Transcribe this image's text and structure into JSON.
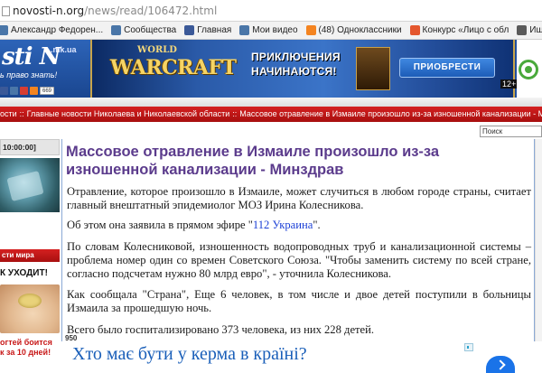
{
  "browser": {
    "url_host": "novosti-n.org",
    "url_path": "/news/read/106472.html"
  },
  "bookmarks": [
    {
      "label": "Александр Федорен...",
      "icon": "vk-icon",
      "color": "#4a76a8"
    },
    {
      "label": "Сообщества",
      "icon": "vk-icon",
      "color": "#4a76a8"
    },
    {
      "label": "Главная",
      "icon": "facebook-icon",
      "color": "#3b5998"
    },
    {
      "label": "Мои видео",
      "icon": "vk-icon",
      "color": "#4a76a8"
    },
    {
      "label": "(48) Одноклассники",
      "icon": "odnoklassniki-icon",
      "color": "#f48420"
    },
    {
      "label": "Конкурс «Лицо с обл",
      "icon": "odnoklassniki-icon",
      "color": "#e4572e"
    },
    {
      "label": "Ищу вокалиста - Ку",
      "icon": "zaycev-icon",
      "color": "#5a5a5a"
    }
  ],
  "site": {
    "logo_text": "sti N",
    "logo_domain": ".mk.ua",
    "logo_tagline": "ь право знать!",
    "social_count": "669",
    "banner": {
      "brand_line1": "WORLD",
      "brand_line2": "WARCRAFT",
      "promo_line1": "ПРИКЛЮЧЕНИЯ",
      "promo_line2": "НАЧИНАЮТСЯ!",
      "button": "ПРИОБРЕСТИ",
      "age": "12+"
    }
  },
  "breadcrumbs": [
    "ости",
    "Главные новости Николаева и Николаевской области",
    "Массовое отравление в Измаиле произошло из-за изношенной канализации - Минздрав"
  ],
  "search": {
    "value": "Поиск"
  },
  "sidebar": {
    "time": "10:00:00]",
    "red_label": "сти мира",
    "headline": "К УХОДИТ!",
    "caption": "огтей боится\nк за 10 дней!"
  },
  "article": {
    "title": "Массовое отравление в Измаиле произошло из-за изношенной канализации - Минздрав",
    "p1": "Отравление, которое произошло в Измаиле, может случиться в любом городе страны, считает главный внештатный эпидемиолог МОЗ Ирина Колесникова.",
    "p2_before": "Об этом она заявила в прямом эфире \"",
    "p2_link": "112 Украина",
    "p2_after": "\".",
    "p3": "По словам Колесниковой, изношенность водопроводных труб  и канализационной системы – проблема номер один со времен Советского Союза.  \"Чтобы заменить систему по всей стране, согласно подсчетам нужно 80 млрд евро\", - уточнила Колесникова.",
    "p4": "Как сообщала \"Страна\", Еще 6 человек, в том числе и двое детей поступили в больницы Измаила за прошедшую ночь.",
    "p5": "Всего было госпитализировано 373 человека, из них 228 детей.",
    "views": "950"
  },
  "ad": {
    "text": "Хто має бути у керма в країні?"
  },
  "colors": {
    "title": "#5b3b8c",
    "nav_red": "#c41a1a",
    "header_blue": "#1f4f9f",
    "link": "#1b3fd6",
    "ad_blue": "#1a5fb9"
  }
}
